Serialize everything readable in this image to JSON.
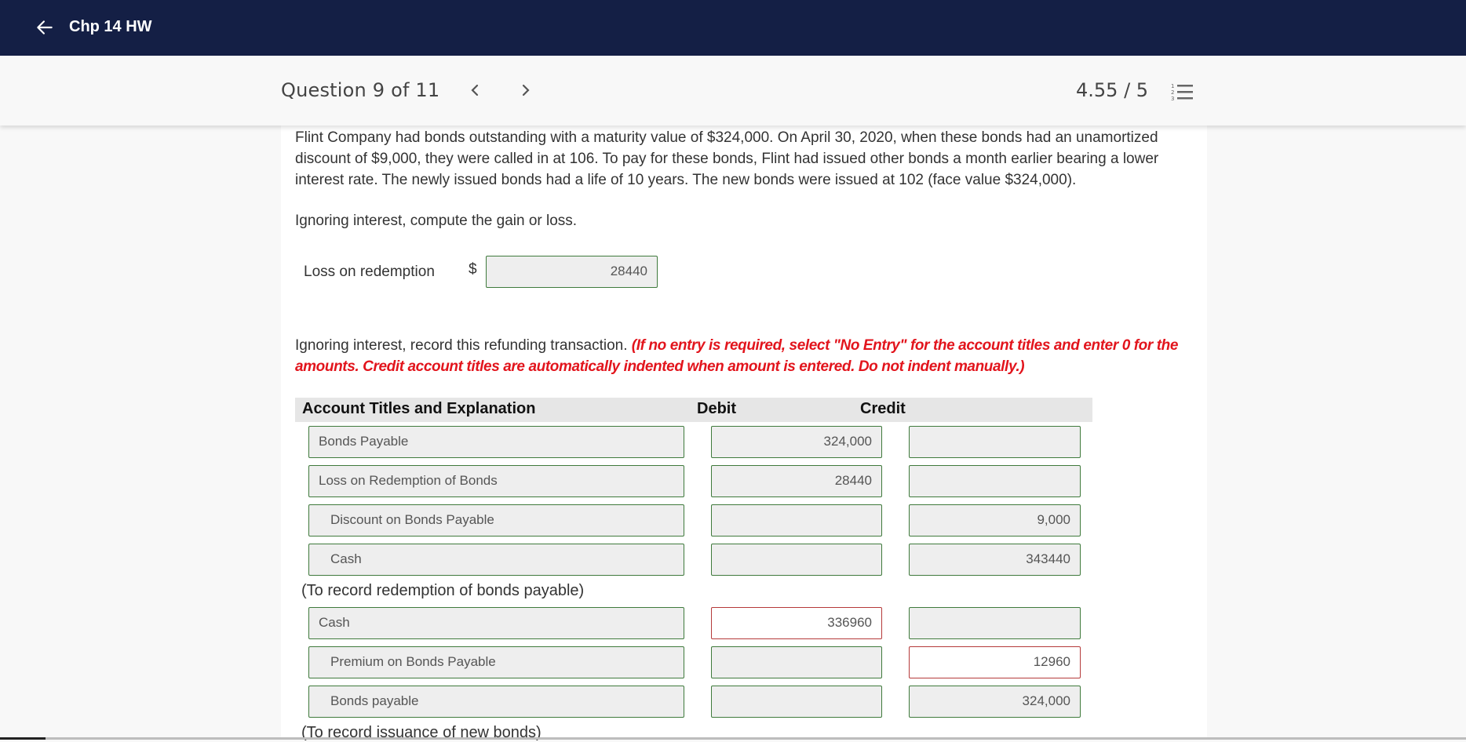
{
  "topbar": {
    "title": "Chp 14 HW",
    "back_icon": "arrow-left-icon"
  },
  "subheader": {
    "question_counter": "Question 9 of 11",
    "prev_icon": "chevron-left-icon",
    "next_icon": "chevron-right-icon",
    "score": "4.55 / 5",
    "list_icon": "numbered-list-icon"
  },
  "question": {
    "paragraph": "Flint Company had bonds outstanding with a maturity value of $324,000. On April 30, 2020, when these bonds had an unamortized discount of $9,000, they were called in at 106. To pay for these bonds, Flint had issued other bonds a month earlier bearing a lower interest rate. The newly issued bonds had a life of 10 years. The new bonds were issued at 102 (face value $324,000).",
    "part1_prompt": "Ignoring interest, compute the gain or loss.",
    "loss_label": "Loss on redemption",
    "currency_symbol": "$",
    "loss_value": "28440",
    "part2_prompt": "Ignoring interest, record this refunding transaction.",
    "part2_instructions": "(If no entry is required, select \"No Entry\" for the account titles and enter 0 for the amounts. Credit account titles are automatically indented when amount is entered. Do not indent manually.)"
  },
  "journal": {
    "headers": {
      "account": "Account Titles and Explanation",
      "debit": "Debit",
      "credit": "Credit"
    },
    "entries": [
      {
        "rows": [
          {
            "account": "Bonds Payable",
            "debit": "324,000",
            "credit": "",
            "indent": false
          },
          {
            "account": "Loss on Redemption of Bonds",
            "debit": "28440",
            "credit": "",
            "indent": false
          },
          {
            "account": "Discount on Bonds Payable",
            "debit": "",
            "credit": "9,000",
            "indent": true
          },
          {
            "account": "Cash",
            "debit": "",
            "credit": "343440",
            "indent": true
          }
        ],
        "memo": "(To record redemption of bonds payable)"
      },
      {
        "rows": [
          {
            "account": "Cash",
            "debit": "336960",
            "credit": "",
            "indent": false,
            "debit_error": true
          },
          {
            "account": "Premium on Bonds Payable",
            "debit": "",
            "credit": "12960",
            "indent": true,
            "credit_error": true
          },
          {
            "account": "Bonds payable",
            "debit": "",
            "credit": "324,000",
            "indent": true
          }
        ],
        "memo": "(To record issuance of new bonds)"
      }
    ]
  },
  "colors": {
    "topbar_bg": "#141f45",
    "correct_border": "#3f7a3c",
    "error_border": "#b53a3a",
    "instruction_red": "#e2141c"
  }
}
